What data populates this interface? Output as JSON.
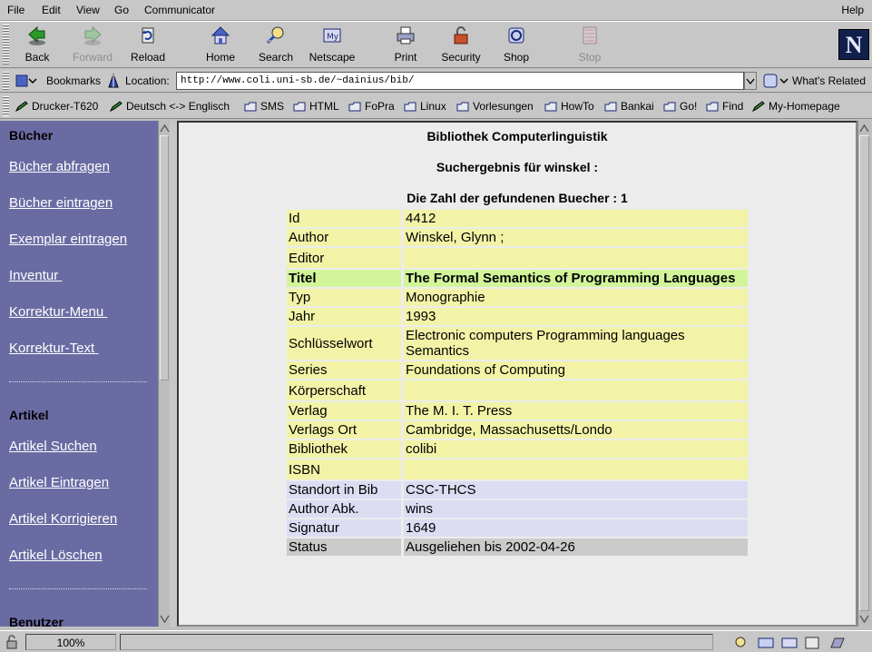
{
  "menubar": {
    "items": [
      "File",
      "Edit",
      "View",
      "Go",
      "Communicator"
    ],
    "help": "Help"
  },
  "toolbar": {
    "buttons": [
      {
        "label": "Back",
        "icon": "back-arrow-icon"
      },
      {
        "label": "Forward",
        "icon": "forward-arrow-icon"
      },
      {
        "label": "Reload",
        "icon": "reload-icon"
      },
      {
        "label": "Home",
        "icon": "home-icon"
      },
      {
        "label": "Search",
        "icon": "search-icon"
      },
      {
        "label": "Netscape",
        "icon": "netscape-icon"
      },
      {
        "label": "Print",
        "icon": "printer-icon"
      },
      {
        "label": "Security",
        "icon": "lock-icon"
      },
      {
        "label": "Shop",
        "icon": "shop-icon"
      },
      {
        "label": "Stop",
        "icon": "stop-icon"
      }
    ]
  },
  "location": {
    "bookmarks_label": "Bookmarks",
    "location_label": "Location:",
    "url": "http://www.coli.uni-sb.de/~dainius/bib/",
    "whats_related": "What's Related"
  },
  "personal": {
    "items": [
      "Drucker-T620",
      "Deutsch <-> Englisch",
      "SMS",
      "HTML",
      "FoPra",
      "Linux",
      "Vorlesungen",
      "HowTo",
      "Bankai",
      "Go!",
      "Find",
      "My-Homepage"
    ]
  },
  "left": {
    "section1": "Bücher",
    "links1": [
      "Bücher abfragen",
      "Bücher eintragen",
      "Exemplar eintragen",
      "Inventur ",
      "Korrektur-Menu ",
      "Korrektur-Text "
    ],
    "section2": "Artikel",
    "links2": [
      "Artikel Suchen",
      "Artikel Eintragen",
      "Artikel Korrigieren",
      "Artikel Löschen"
    ],
    "section3": "Benutzer"
  },
  "main": {
    "title": "Bibliothek Computerlinguistik",
    "subtitle": "Suchergebnis für winskel :",
    "count": "Die Zahl der gefundenen Buecher : 1",
    "rows": [
      {
        "k": "Id",
        "v": "4412"
      },
      {
        "k": "Author",
        "v": "Winskel, Glynn ;"
      },
      {
        "k": "Editor",
        "v": ""
      },
      {
        "k": "Titel",
        "v": " The Formal Semantics of Programming Languages"
      },
      {
        "k": "Typ",
        "v": " Monographie"
      },
      {
        "k": "Jahr",
        "v": "1993"
      },
      {
        "k": "Schlüsselwort",
        "v": " Electronic computers Programming languages Semantics"
      },
      {
        "k": "Series",
        "v": " Foundations of Computing"
      },
      {
        "k": "Körperschaft",
        "v": ""
      },
      {
        "k": "Verlag",
        "v": " The M. I. T. Press"
      },
      {
        "k": "Verlags Ort",
        "v": " Cambridge, Massachusetts/Londo"
      },
      {
        "k": "Bibliothek",
        "v": " colibi"
      },
      {
        "k": "ISBN",
        "v": ""
      },
      {
        "k": "Standort in Bib",
        "v": "CSC-THCS"
      },
      {
        "k": "Author Abk.",
        "v": "wins"
      },
      {
        "k": "Signatur",
        "v": "1649"
      },
      {
        "k": "Status",
        "v": "Ausgeliehen bis 2002-04-26"
      }
    ]
  },
  "status": {
    "zoom": "100%"
  },
  "colors": {
    "left_frame": "#6b6ba3",
    "row_yellow": "#f3f3a8",
    "row_green": "#d2f59a",
    "row_blue": "#dcdcf3",
    "row_grey": "#cbcbcb"
  }
}
